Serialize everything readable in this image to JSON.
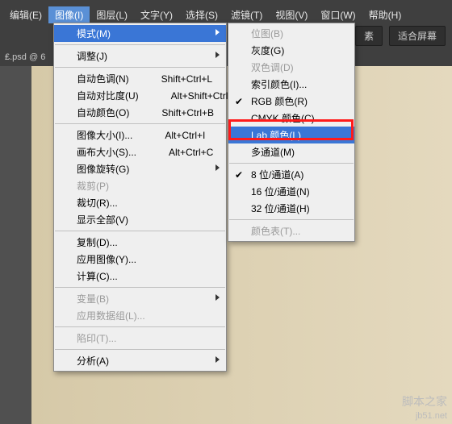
{
  "menubar": {
    "items": [
      {
        "label": "编辑(E)"
      },
      {
        "label": "图像(I)"
      },
      {
        "label": "图层(L)"
      },
      {
        "label": "文字(Y)"
      },
      {
        "label": "选择(S)"
      },
      {
        "label": "滤镜(T)"
      },
      {
        "label": "视图(V)"
      },
      {
        "label": "窗口(W)"
      },
      {
        "label": "帮助(H)"
      }
    ],
    "active_index": 1
  },
  "toolbar": {
    "btn_pixels": "素",
    "btn_fit": "适合屏幕"
  },
  "doctab": {
    "text": "₤.psd @ 6"
  },
  "watermark": {
    "url": "jb51.net",
    "cn": "脚本之家"
  },
  "menu1": {
    "mode": {
      "label": "模式(M)",
      "hl": true,
      "submenu": true
    },
    "adjust": {
      "label": "调整(J)",
      "submenu": true
    },
    "auto_tone": {
      "label": "自动色调(N)",
      "sc": "Shift+Ctrl+L"
    },
    "auto_contrast": {
      "label": "自动对比度(U)",
      "sc": "Alt+Shift+Ctrl+L"
    },
    "auto_color": {
      "label": "自动颜色(O)",
      "sc": "Shift+Ctrl+B"
    },
    "image_size": {
      "label": "图像大小(I)...",
      "sc": "Alt+Ctrl+I"
    },
    "canvas_size": {
      "label": "画布大小(S)...",
      "sc": "Alt+Ctrl+C"
    },
    "rotate": {
      "label": "图像旋转(G)",
      "submenu": true
    },
    "crop": {
      "label": "裁剪(P)"
    },
    "trim": {
      "label": "裁切(R)..."
    },
    "reveal": {
      "label": "显示全部(V)"
    },
    "duplicate": {
      "label": "复制(D)..."
    },
    "apply": {
      "label": "应用图像(Y)..."
    },
    "calc": {
      "label": "计算(C)..."
    },
    "variables": {
      "label": "变量(B)",
      "submenu": true
    },
    "datasets": {
      "label": "应用数据组(L)..."
    },
    "trap": {
      "label": "陷印(T)..."
    },
    "analysis": {
      "label": "分析(A)",
      "submenu": true
    }
  },
  "menu2": {
    "bitmap": {
      "label": "位图(B)"
    },
    "gray": {
      "label": "灰度(G)"
    },
    "duotone": {
      "label": "双色调(D)"
    },
    "indexed": {
      "label": "索引颜色(I)..."
    },
    "rgb": {
      "label": "RGB 颜色(R)",
      "checked": true
    },
    "cmyk": {
      "label": "CMYK 颜色(C)"
    },
    "lab": {
      "label": "Lab 颜色(L)",
      "hl": true
    },
    "multi": {
      "label": "多通道(M)"
    },
    "bit8": {
      "label": "8 位/通道(A)",
      "checked": true
    },
    "bit16": {
      "label": "16 位/通道(N)"
    },
    "bit32": {
      "label": "32 位/通道(H)"
    },
    "colortable": {
      "label": "颜色表(T)..."
    }
  }
}
